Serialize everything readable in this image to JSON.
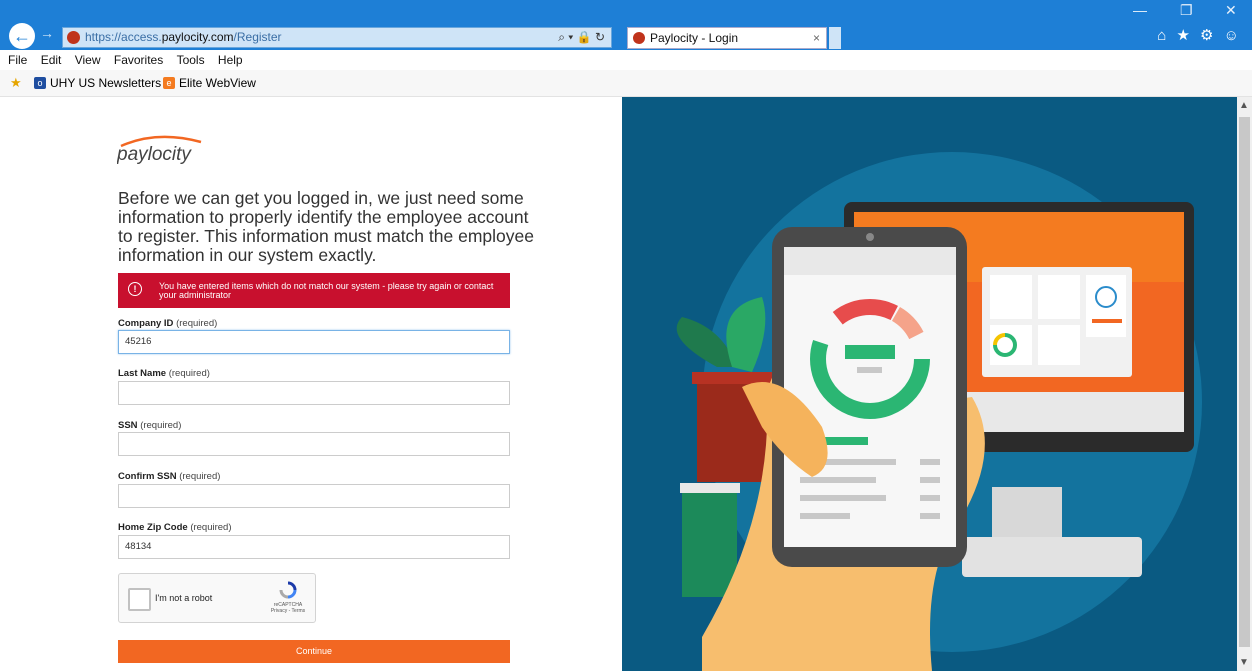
{
  "browser": {
    "url_prefix": "https://access.",
    "url_domain": "paylocity.com",
    "url_path": "/Register",
    "tab_title": "Paylocity - Login",
    "tab_close": "×",
    "address_tools": "⌕ ▾ 🔒 ↻",
    "window_controls": [
      "—",
      "❐",
      "✕"
    ],
    "toolbar_icons": "⌂ ★ ⚙ ☺"
  },
  "menu": [
    "File",
    "Edit",
    "View",
    "Favorites",
    "Tools",
    "Help"
  ],
  "favorites": [
    {
      "label": "UHY US  Newsletters",
      "icon": "o-icon"
    },
    {
      "label": "Elite WebView",
      "icon": "e-icon"
    }
  ],
  "logo_text": "paylocity",
  "intro_text": "Before we can get you logged in, we just need some information to properly identify the employee account to register. This information must match the employee information in our system exactly.",
  "error_message": "You have entered items which do not match our system - please try again or contact your administrator",
  "fields": [
    {
      "label": "Company ID",
      "req": "(required)",
      "value": "45216"
    },
    {
      "label": "Last Name",
      "req": "(required)",
      "value": ""
    },
    {
      "label": "SSN",
      "req": "(required)",
      "value": ""
    },
    {
      "label": "Confirm SSN",
      "req": "(required)",
      "value": ""
    },
    {
      "label": "Home Zip Code",
      "req": "(required)",
      "value": "48134"
    }
  ],
  "captcha": {
    "label": "I'm not a robot",
    "brand": "reCAPTCHA",
    "links": "Privacy - Terms"
  },
  "continue_label": "Continue",
  "colors": {
    "titlebar": "#1e7fd6",
    "error": "#c8102e",
    "accent": "#f26722",
    "illustration_bg": "#0a5a82"
  }
}
